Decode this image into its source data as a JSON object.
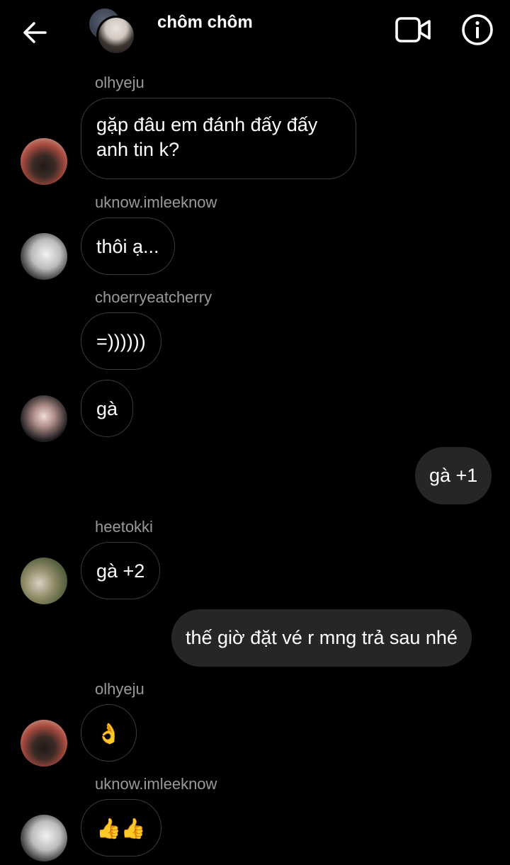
{
  "header": {
    "title": "chôm chôm",
    "icons": {
      "back": "arrow-left-icon",
      "video": "video-call-icon",
      "info": "info-icon"
    }
  },
  "messages": [
    {
      "sender": "olhyeju",
      "text_line1": "gặp đâu em đánh đấy đấy",
      "text_line2": "anh tin k?"
    },
    {
      "sender": "uknow.imleeknow",
      "text": "thôi ạ..."
    },
    {
      "sender": "choerryeatcherry",
      "text": "=))))))"
    },
    {
      "text": "gà"
    },
    {
      "text": "gà +1",
      "outgoing": true
    },
    {
      "sender": "heetokki",
      "text": "gà +2"
    },
    {
      "text": "thế giờ đặt vé r mng trả sau nhé",
      "outgoing": true
    },
    {
      "sender": "olhyeju",
      "text": "👌"
    },
    {
      "sender": "uknow.imleeknow",
      "text": "👍👍"
    }
  ],
  "colors": {
    "background": "#000000",
    "outgoing_bubble": "#262626",
    "sender_name": "#9a9a9a"
  }
}
